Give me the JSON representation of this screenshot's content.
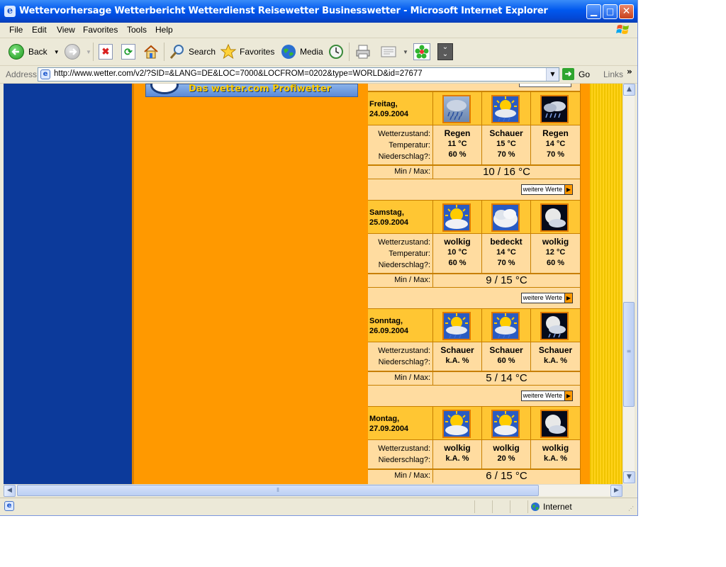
{
  "window": {
    "title": "Wettervorhersage Wetterbericht Wetterdienst Reisewetter Businesswetter - Microsoft Internet Explorer",
    "app_icon": "e",
    "controls": [
      "minimize",
      "maximize",
      "close"
    ]
  },
  "menu": {
    "items": [
      "File",
      "Edit",
      "View",
      "Favorites",
      "Tools",
      "Help"
    ]
  },
  "toolbar": {
    "back_label": "Back",
    "search_label": "Search",
    "favorites_label": "Favorites",
    "media_label": "Media"
  },
  "address": {
    "label": "Address",
    "url": "http://www.wetter.com/v2/?SID=&LANG=DE&LOC=7000&LOCFROM=0202&type=WORLD&id=27677",
    "go_label": "Go",
    "links_label": "Links",
    "links_chevron": "»"
  },
  "banner": {
    "text": "Das wetter.com Profiwetter"
  },
  "labels": {
    "condition": "Wetterzustand:",
    "temperature": "Temperatur:",
    "precipitation": "Niederschlag?:",
    "minmax": "Min / Max:",
    "more": "weitere Werte"
  },
  "days": [
    {
      "name": "Freitag,",
      "date": "24.09.2004",
      "icons": [
        "rain-icon",
        "sun-shower-icon",
        "night-rain-icon"
      ],
      "conditions": [
        "Regen",
        "Schauer",
        "Regen"
      ],
      "temps": [
        "11 °C",
        "15 °C",
        "14 °C"
      ],
      "precip": [
        "60 %",
        "70 %",
        "70 %"
      ],
      "minmax": "10 / 16 °C"
    },
    {
      "name": "Samstag,",
      "date": "25.09.2004",
      "icons": [
        "sun-cloud-icon",
        "cloud-icon",
        "night-cloud-icon"
      ],
      "conditions": [
        "wolkig",
        "bedeckt",
        "wolkig"
      ],
      "temps": [
        "10 °C",
        "14 °C",
        "12 °C"
      ],
      "precip": [
        "60 %",
        "70 %",
        "60 %"
      ],
      "minmax": "9 / 15 °C"
    },
    {
      "name": "Sonntag,",
      "date": "26.09.2004",
      "icons": [
        "sun-shower-icon",
        "sun-shower-icon",
        "night-shower-icon"
      ],
      "conditions": [
        "Schauer",
        "Schauer",
        "Schauer"
      ],
      "precip": [
        "k.A. %",
        "60 %",
        "k.A. %"
      ],
      "minmax": "5 / 14 °C"
    },
    {
      "name": "Montag,",
      "date": "27.09.2004",
      "icons": [
        "sun-cloud-icon",
        "sun-cloud-icon",
        "night-cloud-icon"
      ],
      "conditions": [
        "wolkig",
        "wolkig",
        "wolkig"
      ],
      "precip": [
        "k.A. %",
        "20 %",
        "k.A. %"
      ],
      "minmax": "6 / 15 °C"
    }
  ],
  "status": {
    "zone": "Internet"
  }
}
